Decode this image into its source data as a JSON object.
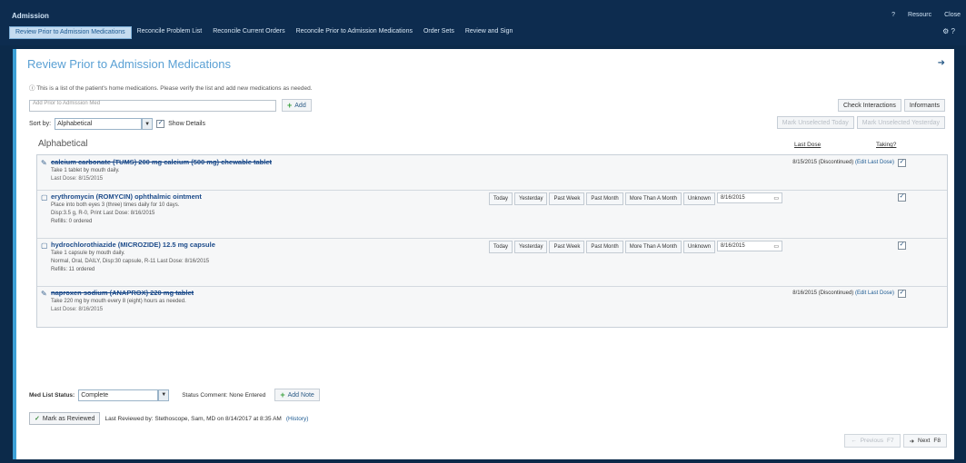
{
  "window": {
    "title": "Admission",
    "help": "?",
    "resources": "Resourc",
    "close": "Close"
  },
  "tabs": [
    "Review Prior to Admission Medications",
    "Reconcile Problem List",
    "Reconcile Current Orders",
    "Reconcile Prior to Admission Medications",
    "Order Sets",
    "Review and Sign"
  ],
  "panel": {
    "title": "Review Prior to Admission Medications",
    "instruction": "This is a list of the patient's home medications. Please verify the list and add new medications as needed.",
    "add_placeholder": "Add Prior to Admission Med",
    "add_label": "Add",
    "check_interactions": "Check Interactions",
    "informants": "Informants",
    "sort_label": "Sort by:",
    "sort_value": "Alphabetical",
    "show_details": "Show Details",
    "mark_unselected_today": "Mark Unselected Today",
    "mark_unselected_yesterday": "Mark Unselected Yesterday",
    "group_title": "Alphabetical",
    "hdr_last_dose": "Last Dose",
    "hdr_taking": "Taking?"
  },
  "time_buttons": [
    "Today",
    "Yesterday",
    "Past Week",
    "Past Month",
    "More Than A Month",
    "Unknown"
  ],
  "medications": [
    {
      "name": "calcium carbonate (TUMS) 200 mg calcium (500 mg) chewable tablet",
      "strike": true,
      "details": [
        "Take 1 tablet by mouth daily."
      ],
      "last_dose": "Last Dose: 8/15/2015",
      "status_date": "8/15/2015 (Discontinued)",
      "status_link": "(Edit Last Dose)",
      "taking": true,
      "show_buttons": false
    },
    {
      "name": "erythromycin (ROMYCIN) ophthalmic ointment",
      "strike": false,
      "details": [
        "Place into both eyes 3 (three) times daily for 10 days.",
        "Disp:3.5 g, R-0, Print Last Dose: 8/16/2015",
        "Refills: 0 ordered"
      ],
      "last_dose": "",
      "date_value": "8/16/2015",
      "taking": true,
      "show_buttons": true
    },
    {
      "name": "hydrochlorothiazide (MICROZIDE) 12.5 mg capsule",
      "strike": false,
      "details": [
        "Take 1 capsule by mouth daily.",
        "Normal, Oral, DAILY, Disp:30 capsule, R-11 Last Dose: 8/16/2015",
        "Refills: 11 ordered"
      ],
      "last_dose": "",
      "date_value": "8/16/2015",
      "taking": true,
      "show_buttons": true
    },
    {
      "name": "naproxen sodium (ANAPROX) 220 mg tablet",
      "strike": true,
      "details": [
        "Take 220 mg by mouth every 8 (eight) hours as needed."
      ],
      "last_dose": "Last Dose: 8/16/2015",
      "status_date": "8/16/2015 (Discontinued)",
      "status_link": "(Edit Last Dose)",
      "taking": true,
      "show_buttons": false
    }
  ],
  "footer": {
    "med_list_status_label": "Med List Status:",
    "med_list_status_value": "Complete",
    "status_comment": "Status Comment: None Entered",
    "add_note": "Add Note",
    "mark_reviewed": "Mark as Reviewed",
    "last_reviewed": "Last Reviewed by: Stethoscope, Sam, MD on 8/14/2017 at 8:35 AM",
    "history": "(History)"
  },
  "nav": {
    "previous": "Previous",
    "previous_key": "F7",
    "next": "Next",
    "next_key": "F8"
  }
}
